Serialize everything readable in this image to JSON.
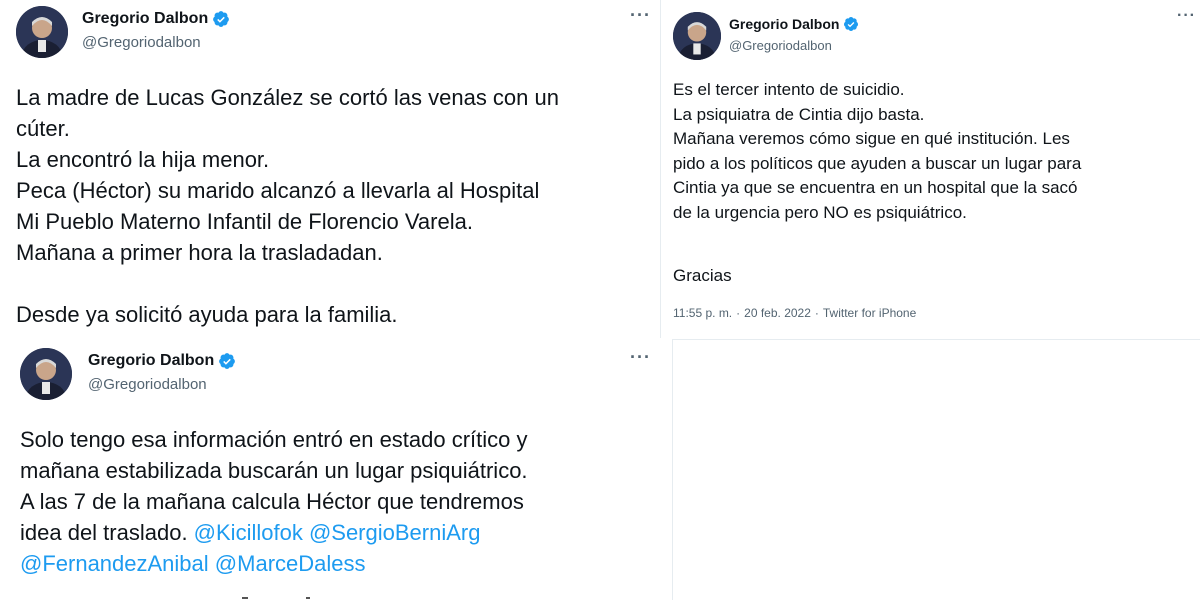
{
  "author": {
    "name": "Gregorio Dalbon",
    "handle": "@Gregoriodalbon",
    "verified_color": "#1d9bf0"
  },
  "more_glyph": "···",
  "tweet_a": {
    "text": "La madre de Lucas González  se cortó las venas con un\ncúter.\nLa encontró la hija menor.\nPeca (Héctor) su marido alcanzó a llevarla al Hospital\nMi Pueblo Materno Infantil de Florencio Varela.\nMañana a primer hora la trasladadan.\n\nDesde ya solicitó ayuda para la familia."
  },
  "tweet_b": {
    "text": "Solo tengo esa información entró en estado crítico y\nmañana estabilizada buscarán un lugar psiquiátrico.\nA las 7 de la mañana calcula Héctor que tendremos\nidea del traslado. ",
    "mentions": [
      "@Kicillofok",
      "@SergioBerniArg",
      "@FernandezAnibal",
      "@MarceDaless"
    ]
  },
  "tweet_c": {
    "text": "Es el tercer intento de suicidio.\nLa psiquiatra de Cintia dijo basta.\nMañana veremos cómo sigue en qué institución. Les\npido a los políticos que ayuden a buscar un lugar para\nCintia ya que se encuentra en un hospital que la sacó\nde la urgencia pero NO es psiquiátrico.",
    "thanks": "Gracias",
    "time": "11:55 p. m.",
    "date": "20 feb. 2022",
    "source": "Twitter for iPhone",
    "separator": "·"
  },
  "colors": {
    "text": "#0f1419",
    "secondary": "#536471",
    "link": "#1d9bf0"
  }
}
